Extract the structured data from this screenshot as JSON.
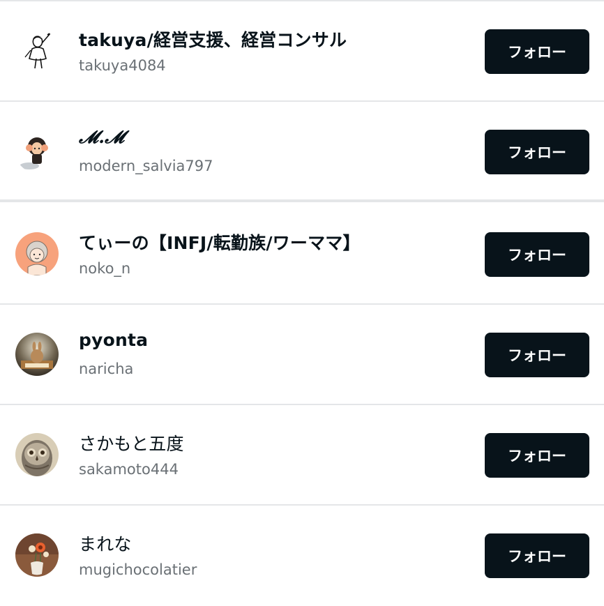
{
  "users": [
    {
      "name": "takuya/経営支援、経営コンサル",
      "handle": "takuya4084",
      "follow_label": "フォロー",
      "avatar_icon": "sketch-man-icon"
    },
    {
      "name": "𝓜.𝓜",
      "handle": "modern_salvia797",
      "follow_label": "フォロー",
      "avatar_icon": "girl-illustration-icon"
    },
    {
      "name": "てぃーの【INFJ/転勤族/ワーママ】",
      "handle": "noko_n",
      "follow_label": "フォロー",
      "avatar_icon": "grandma-illustration-icon"
    },
    {
      "name": "pyonta",
      "handle": "naricha",
      "follow_label": "フォロー",
      "avatar_icon": "rabbit-book-photo-icon"
    },
    {
      "name": "さかもと五度",
      "handle": "sakamoto444",
      "follow_label": "フォロー",
      "avatar_icon": "owl-photo-icon"
    },
    {
      "name": "まれな",
      "handle": "mugichocolatier",
      "follow_label": "フォロー",
      "avatar_icon": "flower-vase-photo-icon"
    }
  ],
  "colors": {
    "button_bg": "#08131a",
    "button_text": "#ffffff",
    "name_text": "#08131a",
    "handle_text": "#6a7075",
    "divider": "#e4e6e8"
  }
}
